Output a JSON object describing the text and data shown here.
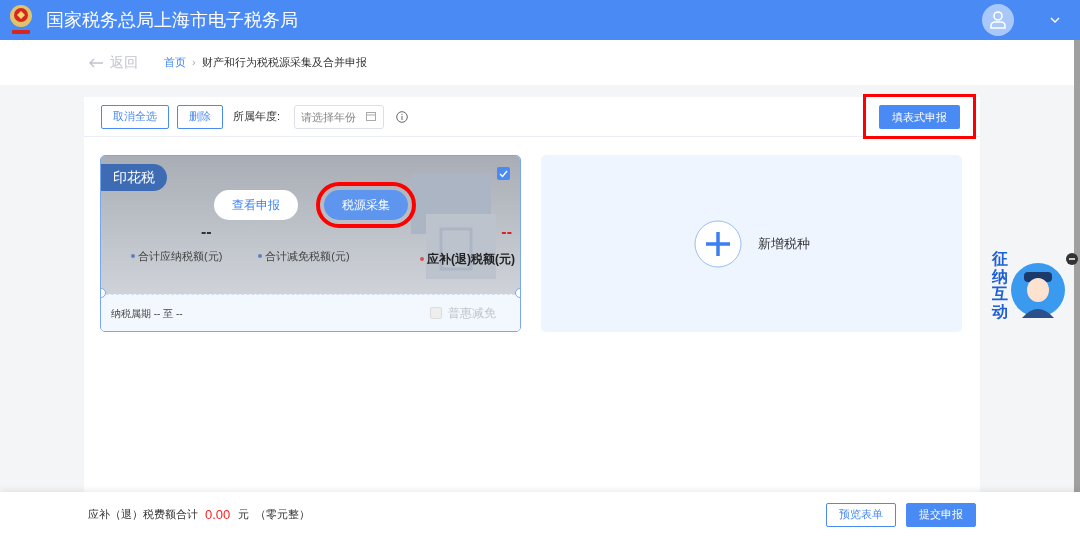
{
  "header": {
    "title": "国家税务总局上海市电子税务局"
  },
  "nav": {
    "back": "返回",
    "separator": "›",
    "breadcrumb": [
      {
        "label": "首页",
        "link": true
      },
      {
        "label": "财产和行为税税源采集及合并申报",
        "link": false
      }
    ]
  },
  "toolbar": {
    "buttons": [
      "取消全选",
      "删除"
    ],
    "year_label": "所属年度:",
    "year_field": {
      "placeholder": "请选择年份"
    },
    "primary_button": {
      "label": "填表式申报",
      "highlighted": true
    }
  },
  "tax_cards": [
    {
      "tax": "印花税",
      "checked": true,
      "actions": [
        {
          "label": "查看申报",
          "kind": "outline",
          "highlighted": false
        },
        {
          "label": "税源采集",
          "kind": "primary",
          "highlighted": true
        }
      ],
      "amount": "--",
      "stats": [
        "合计应纳税额(元)",
        "合计减免税额(元)"
      ],
      "payable": {
        "value": "--",
        "label": "应补(退)税额(元)"
      },
      "period": "纳税属期 -- 至 --",
      "relief": {
        "label": "普惠减免",
        "checked": false,
        "disabled": true
      }
    }
  ],
  "add_card": {
    "label": "新增税种"
  },
  "assistant": {
    "label": "征纳互动"
  },
  "footer": {
    "total_label": "应补（退）税费额合计",
    "amount": "0.00",
    "unit": "元",
    "amount_words": "（零元整）",
    "buttons": [
      {
        "label": "预览表单",
        "kind": "outline"
      },
      {
        "label": "提交申报",
        "kind": "primary"
      }
    ]
  }
}
